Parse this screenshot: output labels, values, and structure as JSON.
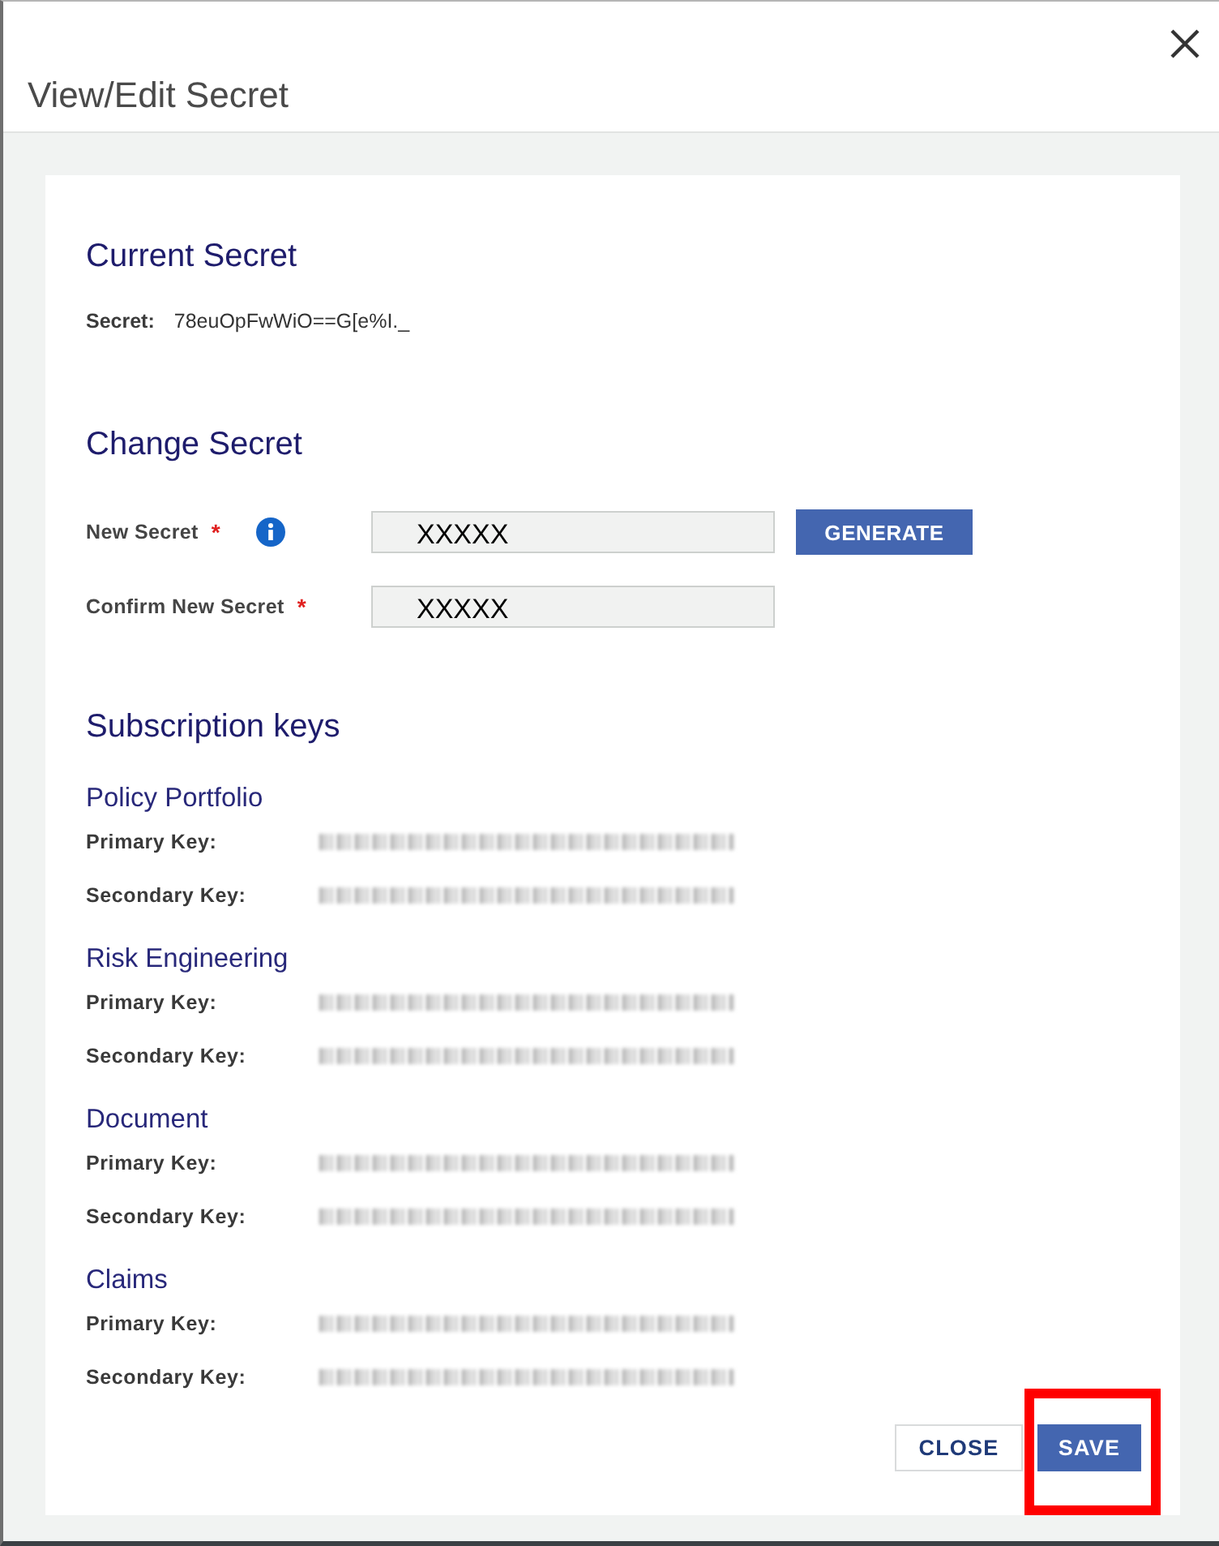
{
  "dialog": {
    "title": "View/Edit Secret"
  },
  "current_secret": {
    "heading": "Current Secret",
    "label": "Secret:",
    "value": "78euOpFwWiO==G[e%I._"
  },
  "change_secret": {
    "heading": "Change Secret",
    "fields": [
      {
        "label": "New Secret",
        "required_mark": "*",
        "info": true,
        "value": "XXXXX"
      },
      {
        "label": "Confirm New Secret",
        "required_mark": "*",
        "info": false,
        "value": "XXXXX"
      }
    ],
    "generate_button": "GENERATE"
  },
  "subscription_keys": {
    "heading": "Subscription keys",
    "products": [
      {
        "name": "Policy Portfolio",
        "keys": [
          {
            "label": "Primary Key:"
          },
          {
            "label": "Secondary Key:"
          }
        ]
      },
      {
        "name": "Risk Engineering",
        "keys": [
          {
            "label": "Primary Key:"
          },
          {
            "label": "Secondary Key:"
          }
        ]
      },
      {
        "name": "Document",
        "keys": [
          {
            "label": "Primary Key:"
          },
          {
            "label": "Secondary Key:"
          }
        ]
      },
      {
        "name": "Claims",
        "keys": [
          {
            "label": "Primary Key:"
          },
          {
            "label": "Secondary Key:"
          }
        ]
      }
    ]
  },
  "buttons": [
    {
      "label": "CLOSE",
      "kind": "secondary",
      "highlighted": false
    },
    {
      "label": "SAVE",
      "kind": "primary",
      "highlighted": true
    }
  ]
}
